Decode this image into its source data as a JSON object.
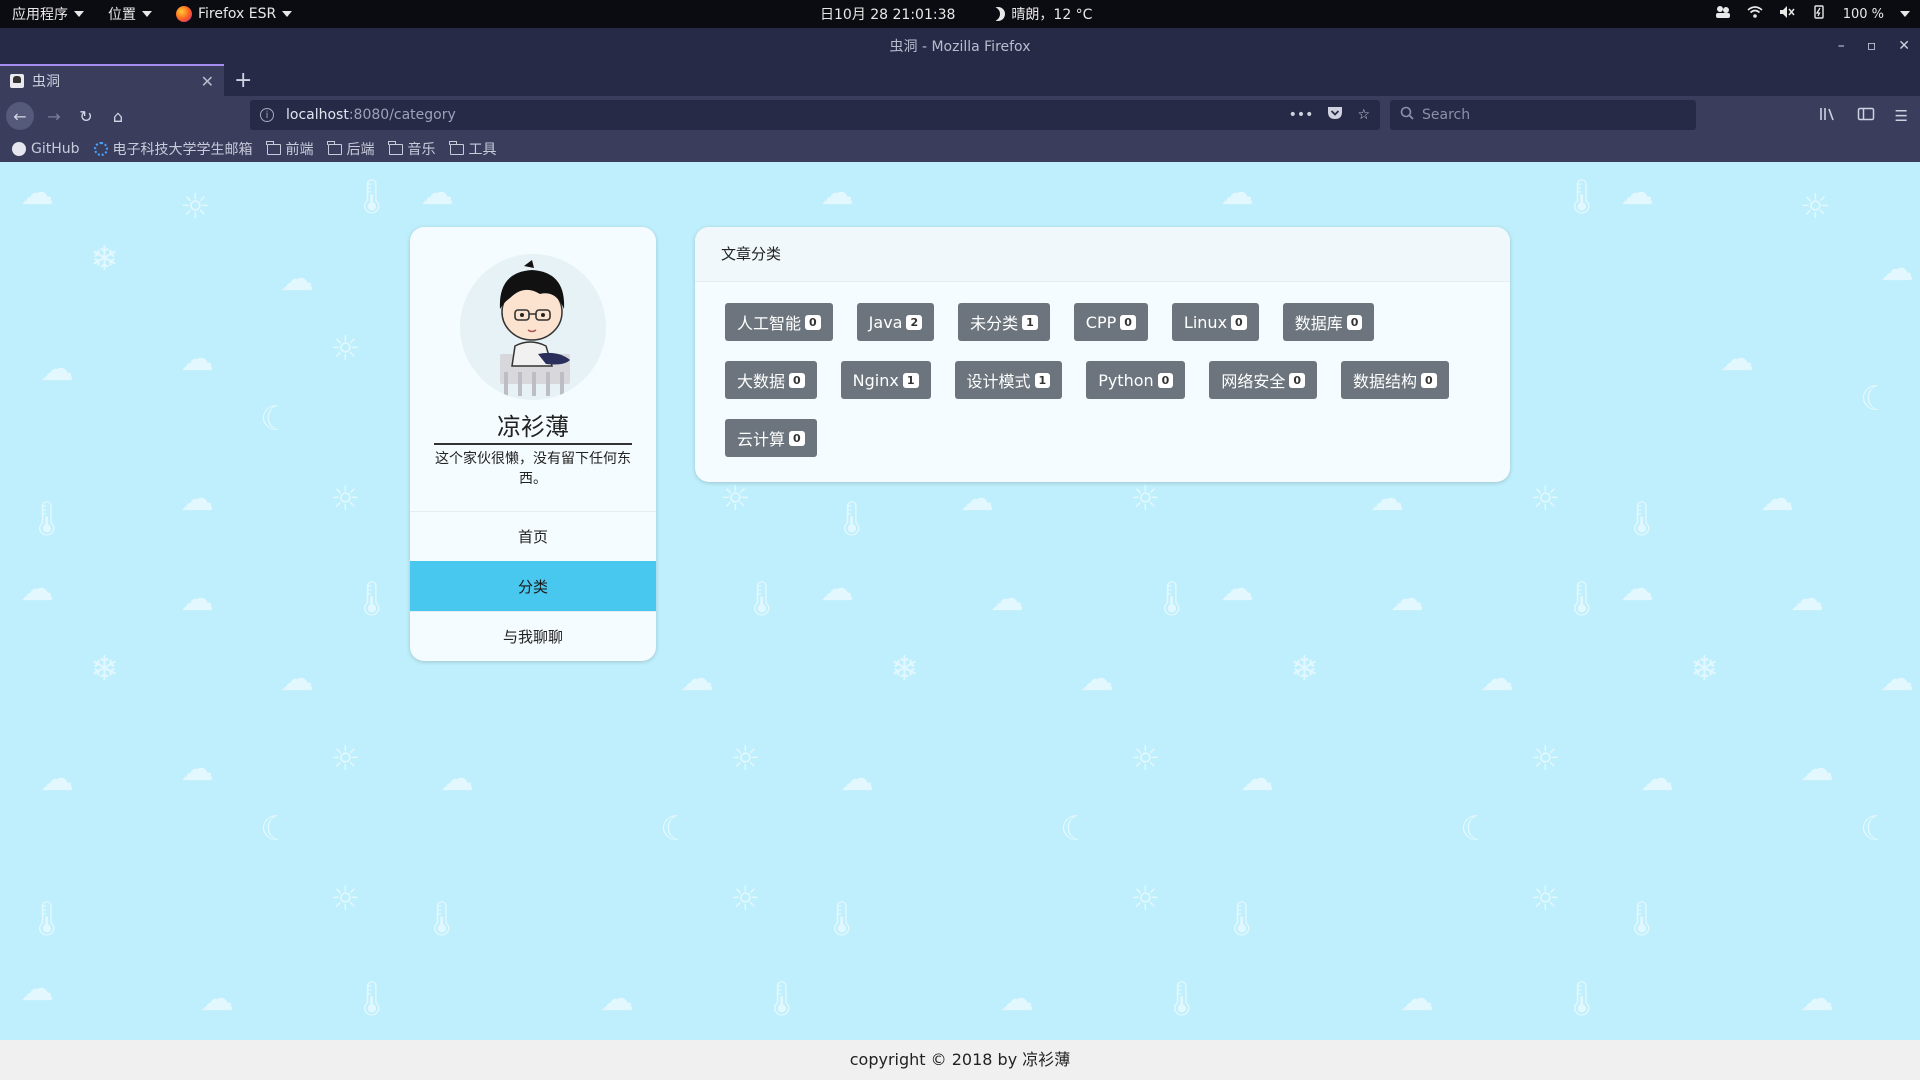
{
  "os_panel": {
    "apps_label": "应用程序",
    "places_label": "位置",
    "browser_label": "Firefox ESR",
    "datetime": "日10月 28  21:01:38",
    "weather": "晴朗，12 °C",
    "volume": "100 %"
  },
  "window": {
    "title": "虫洞 - Mozilla Firefox",
    "tab_title": "虫洞",
    "url_host": "localhost",
    "url_path": ":8080/category",
    "search_placeholder": "Search"
  },
  "bookmarks": [
    {
      "label": "GitHub",
      "icon": "github-icon"
    },
    {
      "label": "电子科技大学学生邮箱",
      "icon": "uestc-icon"
    },
    {
      "label": "前端",
      "icon": "folder-icon"
    },
    {
      "label": "后端",
      "icon": "folder-icon"
    },
    {
      "label": "音乐",
      "icon": "folder-icon"
    },
    {
      "label": "工具",
      "icon": "folder-icon"
    }
  ],
  "profile": {
    "name": "凉衫薄",
    "bio": "这个家伙很懒，没有留下任何东西。",
    "menu": [
      {
        "label": "首页",
        "active": false
      },
      {
        "label": "分类",
        "active": true
      },
      {
        "label": "与我聊聊",
        "active": false
      }
    ]
  },
  "categories": {
    "title": "文章分类",
    "items": [
      {
        "name": "人工智能",
        "count": "0"
      },
      {
        "name": "Java",
        "count": "2"
      },
      {
        "name": "未分类",
        "count": "1"
      },
      {
        "name": "CPP",
        "count": "0"
      },
      {
        "name": "Linux",
        "count": "0"
      },
      {
        "name": "数据库",
        "count": "0"
      },
      {
        "name": "大数据",
        "count": "0"
      },
      {
        "name": "Nginx",
        "count": "1"
      },
      {
        "name": "设计模式",
        "count": "1"
      },
      {
        "name": "Python",
        "count": "0"
      },
      {
        "name": "网络安全",
        "count": "0"
      },
      {
        "name": "数据结构",
        "count": "0"
      },
      {
        "name": "云计算",
        "count": "0"
      }
    ]
  },
  "footer": {
    "text": "copyright © 2018 by 凉衫薄"
  },
  "colors": {
    "page_bg": "#bfeffc",
    "active_menu": "#49c8ef",
    "category_button": "#6c757d"
  }
}
